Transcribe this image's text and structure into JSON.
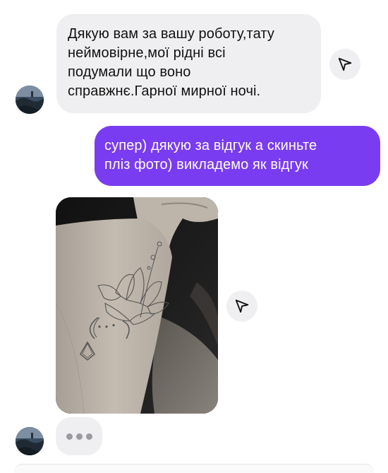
{
  "conversation": {
    "messages": [
      {
        "direction": "incoming",
        "type": "text",
        "text": "Дякую вам за вашу роботу,тату\nнеймовірне,мої рідні всі\nподумали що воно\nсправжнє.Гарної мирної ночі."
      },
      {
        "direction": "outgoing",
        "type": "text",
        "text": "супер) дякую за відгук а скиньте\nпліз фото) викладемо як відгук"
      },
      {
        "direction": "incoming",
        "type": "photo",
        "image_description_icon": "forearm-tattoo-photo"
      }
    ],
    "typing_indicator": true
  },
  "icons": {
    "share": "paper-plane-icon",
    "avatar": "contact-avatar"
  },
  "colors": {
    "incoming_bubble": "#efeff1",
    "outgoing_bubble": "#7a3cf0",
    "outgoing_text": "#ffffff",
    "incoming_text": "#111111"
  }
}
